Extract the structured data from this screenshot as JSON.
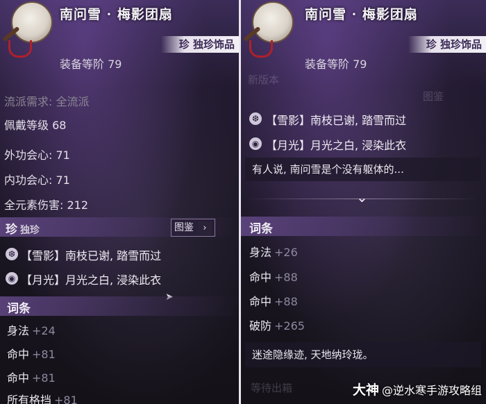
{
  "left": {
    "item_name": "南问雪 · 梅影团扇",
    "quality_tag": "珍 独珍饰品",
    "equip_level": "装备等阶 79",
    "stats": [
      {
        "text": "流派需求: 全流派",
        "dim": true
      },
      {
        "text": "佩戴等级 68",
        "dim": false
      },
      {
        "text": "外功会心: 71",
        "dim": false
      },
      {
        "text": "内功会心: 71",
        "dim": false
      },
      {
        "text": "全元素伤害: 212",
        "dim": false
      }
    ],
    "unique_section": {
      "title": "珍",
      "subtitle": "独珍",
      "codex_label": "图鉴",
      "codex_arrow": "›"
    },
    "effects": [
      {
        "icon": "snowflake-icon",
        "glyph": "❆",
        "text": "【雪影】南枝已谢, 踏雪而过"
      },
      {
        "icon": "moon-swirl-icon",
        "glyph": "◉",
        "text": "【月光】月光之白, 浸染此衣"
      }
    ],
    "affix_section": {
      "title": "词条"
    },
    "affixes": [
      {
        "name": "身法",
        "value": "+24"
      },
      {
        "name": "命中",
        "value": "+81"
      },
      {
        "name": "命中",
        "value": "+81"
      },
      {
        "name": "所有格挡",
        "value": "+81"
      }
    ]
  },
  "right": {
    "item_name": "南问雪 · 梅影团扇",
    "quality_tag": "珍 独珍饰品",
    "equip_level": "装备等阶 79",
    "ghost_texts": [
      "新版本",
      "图鉴"
    ],
    "effects": [
      {
        "icon": "snowflake-icon",
        "glyph": "❆",
        "text": "【雪影】南枝已谢, 踏雪而过"
      },
      {
        "icon": "moon-swirl-icon",
        "glyph": "◉",
        "text": "【月光】月光之白, 浸染此衣"
      }
    ],
    "description": "有人说, 南问雪是个没有躯体的...",
    "expand_icon": "⌄",
    "affix_section": {
      "title": "词条"
    },
    "affixes": [
      {
        "name": "身法",
        "value": "+26"
      },
      {
        "name": "命中",
        "value": "+88"
      },
      {
        "name": "命中",
        "value": "+88"
      },
      {
        "name": "破防",
        "value": "+265"
      }
    ],
    "flavor_text": "迷途隐缘迹, 天地纳玲珑。",
    "ghost_bottom": "等待出箱"
  },
  "watermark": {
    "brand": "大神",
    "account": "@逆水寒手游攻略组"
  },
  "colors": {
    "accent_purple": "#6e5096",
    "panel_dark": "#1a1622",
    "tag_bg": "#f2eff5",
    "tag_text": "#3b2a55"
  }
}
